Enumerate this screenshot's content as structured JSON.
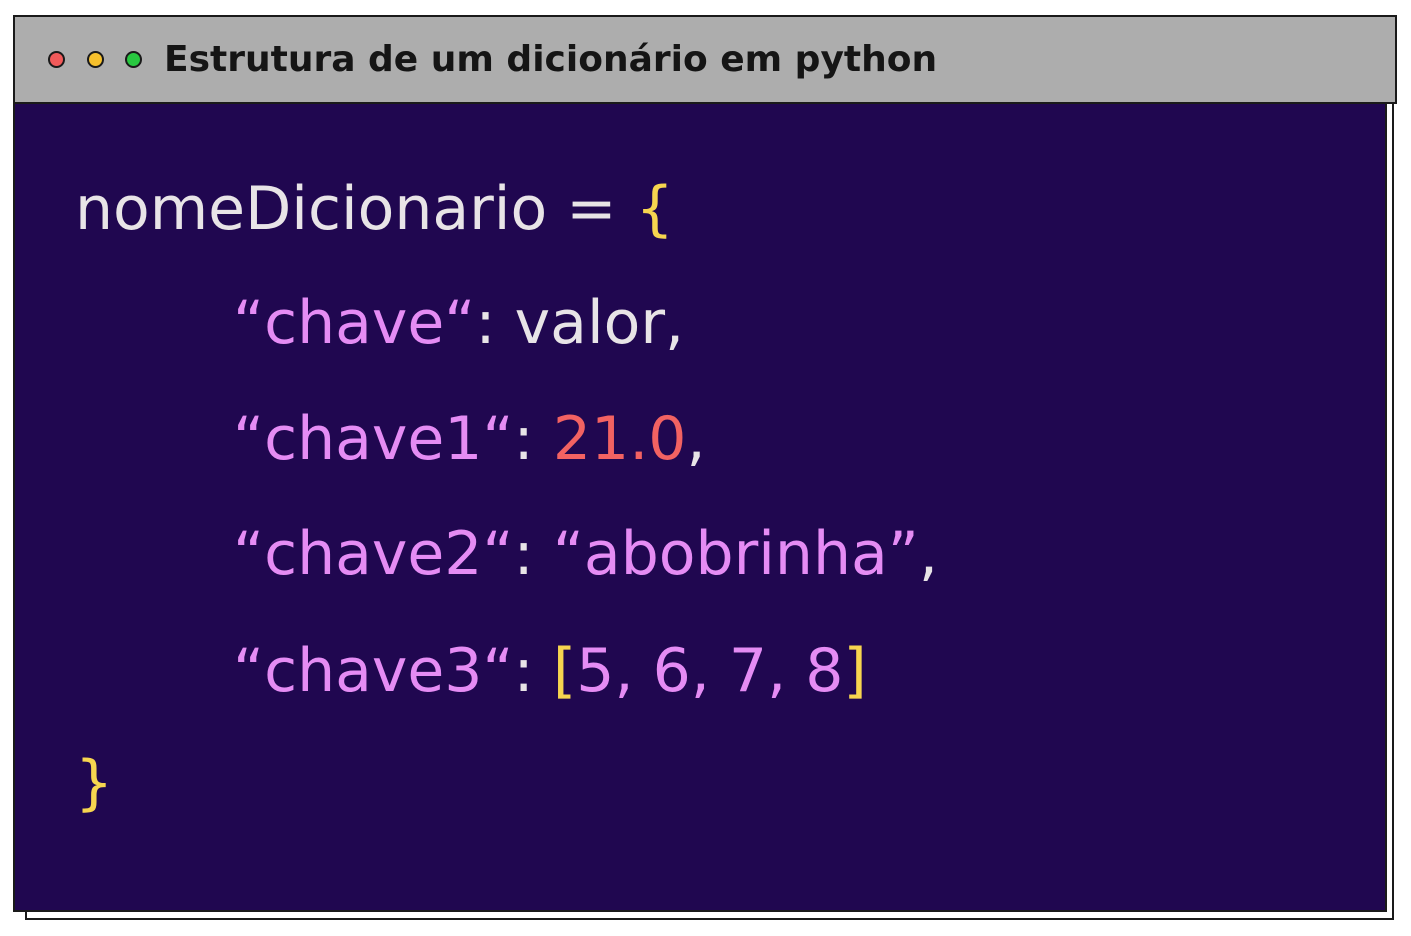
{
  "window": {
    "title": "Estrutura de um dicionário em python",
    "buttons": {
      "close_color": "#f15a5a",
      "minimize_color": "#f6c02c",
      "maximize_color": "#28c840"
    }
  },
  "colors": {
    "background": "#200750",
    "titlebar": "#adadad",
    "default_text": "#e8e4e7",
    "brace": "#f7d54f",
    "key_string": "#e58cf4",
    "number_float": "#f26262",
    "list_values": "#e58cf4"
  },
  "code": {
    "line1": {
      "name": "nomeDicionario",
      "op": " = ",
      "open_brace": "{"
    },
    "line2": {
      "key": "“chave“",
      "colon": ": ",
      "value": "valor",
      "comma": ","
    },
    "line3": {
      "key": "“chave1“",
      "colon": ": ",
      "value": "21.0",
      "comma": ","
    },
    "line4": {
      "key": "“chave2“",
      "colon": ": ",
      "value": "“abobrinha”",
      "comma": ","
    },
    "line5": {
      "key": "“chave3“",
      "colon": ": ",
      "open_bracket": "[",
      "values": "5, 6, 7, 8",
      "close_bracket": "]"
    },
    "line6": {
      "close_brace": "}"
    }
  }
}
